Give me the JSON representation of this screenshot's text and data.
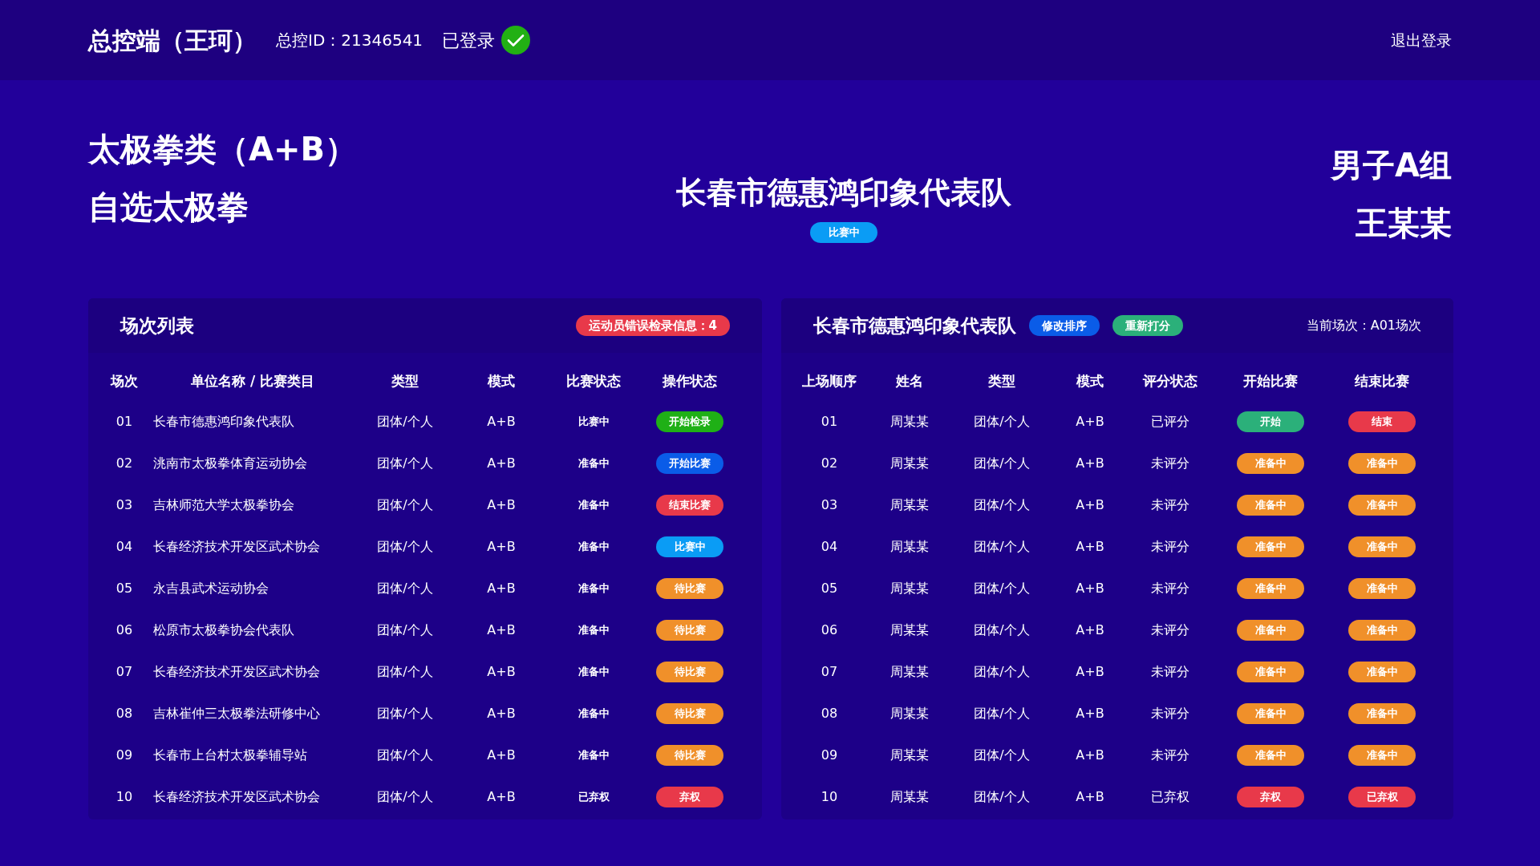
{
  "header": {
    "title": "总控端（王珂）",
    "id_label": "总控ID：21346541",
    "status_label": "已登录",
    "logged_in": true,
    "logout": "退出登录"
  },
  "event": {
    "category": "太极拳类（A+B）",
    "routine": "自选太极拳",
    "team": "长春市德惠鸿印象代表队",
    "status_pill": {
      "text": "比赛中",
      "color": "#0a9cf5"
    },
    "group": "男子A组",
    "athlete": "王某某"
  },
  "left_panel": {
    "title": "场次列表",
    "alert_badge": "运动员错误检录信息：4",
    "columns": [
      "场次",
      "单位名称 / 比赛类目",
      "类型",
      "模式",
      "比赛状态",
      "操作状态"
    ],
    "rows": [
      {
        "no": "01",
        "unit": "长春市德惠鸿印象代表队",
        "type": "团体/个人",
        "mode": "A+B",
        "match_status": "比赛中",
        "action": {
          "text": "开始检录",
          "color": "#1fb016"
        }
      },
      {
        "no": "02",
        "unit": "洮南市太极拳体育运动协会",
        "type": "团体/个人",
        "mode": "A+B",
        "match_status": "准备中",
        "action": {
          "text": "开始比赛",
          "color": "#0a5ce8"
        }
      },
      {
        "no": "03",
        "unit": "吉林师范大学太极拳协会",
        "type": "团体/个人",
        "mode": "A+B",
        "match_status": "准备中",
        "action": {
          "text": "结束比赛",
          "color": "#e8394a"
        }
      },
      {
        "no": "04",
        "unit": "长春经济技术开发区武术协会",
        "type": "团体/个人",
        "mode": "A+B",
        "match_status": "准备中",
        "action": {
          "text": "比赛中",
          "color": "#0a9cf5"
        }
      },
      {
        "no": "05",
        "unit": "永吉县武术运动协会",
        "type": "团体/个人",
        "mode": "A+B",
        "match_status": "准备中",
        "action": {
          "text": "待比赛",
          "color": "#f0902a"
        }
      },
      {
        "no": "06",
        "unit": "松原市太极拳协会代表队",
        "type": "团体/个人",
        "mode": "A+B",
        "match_status": "准备中",
        "action": {
          "text": "待比赛",
          "color": "#f0902a"
        }
      },
      {
        "no": "07",
        "unit": "长春经济技术开发区武术协会",
        "type": "团体/个人",
        "mode": "A+B",
        "match_status": "准备中",
        "action": {
          "text": "待比赛",
          "color": "#f0902a"
        }
      },
      {
        "no": "08",
        "unit": "吉林崔仲三太极拳法研修中心",
        "type": "团体/个人",
        "mode": "A+B",
        "match_status": "准备中",
        "action": {
          "text": "待比赛",
          "color": "#f0902a"
        }
      },
      {
        "no": "09",
        "unit": "长春市上台村太极拳辅导站",
        "type": "团体/个人",
        "mode": "A+B",
        "match_status": "准备中",
        "action": {
          "text": "待比赛",
          "color": "#f0902a"
        }
      },
      {
        "no": "10",
        "unit": "长春经济技术开发区武术协会",
        "type": "团体/个人",
        "mode": "A+B",
        "match_status": "已弃权",
        "action": {
          "text": "弃权",
          "color": "#e8394a"
        }
      }
    ]
  },
  "right_panel": {
    "title": "长春市德惠鸿印象代表队",
    "buttons": [
      {
        "label": "修改排序",
        "color": "#0a5ce8"
      },
      {
        "label": "重新打分",
        "color": "#2bb07a"
      }
    ],
    "current": "当前场次：A01场次",
    "columns": [
      "上场顺序",
      "姓名",
      "类型",
      "模式",
      "评分状态",
      "开始比赛",
      "结束比赛"
    ],
    "rows": [
      {
        "order": "01",
        "name": "周某某",
        "type": "团体/个人",
        "mode": "A+B",
        "score_status": "已评分",
        "start": {
          "text": "开始",
          "color": "#2bb07a"
        },
        "end": {
          "text": "结束",
          "color": "#e8394a"
        }
      },
      {
        "order": "02",
        "name": "周某某",
        "type": "团体/个人",
        "mode": "A+B",
        "score_status": "未评分",
        "start": {
          "text": "准备中",
          "color": "#f0902a"
        },
        "end": {
          "text": "准备中",
          "color": "#f0902a"
        }
      },
      {
        "order": "03",
        "name": "周某某",
        "type": "团体/个人",
        "mode": "A+B",
        "score_status": "未评分",
        "start": {
          "text": "准备中",
          "color": "#f0902a"
        },
        "end": {
          "text": "准备中",
          "color": "#f0902a"
        }
      },
      {
        "order": "04",
        "name": "周某某",
        "type": "团体/个人",
        "mode": "A+B",
        "score_status": "未评分",
        "start": {
          "text": "准备中",
          "color": "#f0902a"
        },
        "end": {
          "text": "准备中",
          "color": "#f0902a"
        }
      },
      {
        "order": "05",
        "name": "周某某",
        "type": "团体/个人",
        "mode": "A+B",
        "score_status": "未评分",
        "start": {
          "text": "准备中",
          "color": "#f0902a"
        },
        "end": {
          "text": "准备中",
          "color": "#f0902a"
        }
      },
      {
        "order": "06",
        "name": "周某某",
        "type": "团体/个人",
        "mode": "A+B",
        "score_status": "未评分",
        "start": {
          "text": "准备中",
          "color": "#f0902a"
        },
        "end": {
          "text": "准备中",
          "color": "#f0902a"
        }
      },
      {
        "order": "07",
        "name": "周某某",
        "type": "团体/个人",
        "mode": "A+B",
        "score_status": "未评分",
        "start": {
          "text": "准备中",
          "color": "#f0902a"
        },
        "end": {
          "text": "准备中",
          "color": "#f0902a"
        }
      },
      {
        "order": "08",
        "name": "周某某",
        "type": "团体/个人",
        "mode": "A+B",
        "score_status": "未评分",
        "start": {
          "text": "准备中",
          "color": "#f0902a"
        },
        "end": {
          "text": "准备中",
          "color": "#f0902a"
        }
      },
      {
        "order": "09",
        "name": "周某某",
        "type": "团体/个人",
        "mode": "A+B",
        "score_status": "未评分",
        "start": {
          "text": "准备中",
          "color": "#f0902a"
        },
        "end": {
          "text": "准备中",
          "color": "#f0902a"
        }
      },
      {
        "order": "10",
        "name": "周某某",
        "type": "团体/个人",
        "mode": "A+B",
        "score_status": "已弃权",
        "start": {
          "text": "弃权",
          "color": "#e8394a"
        },
        "end": {
          "text": "已弃权",
          "color": "#e8394a"
        }
      }
    ]
  }
}
